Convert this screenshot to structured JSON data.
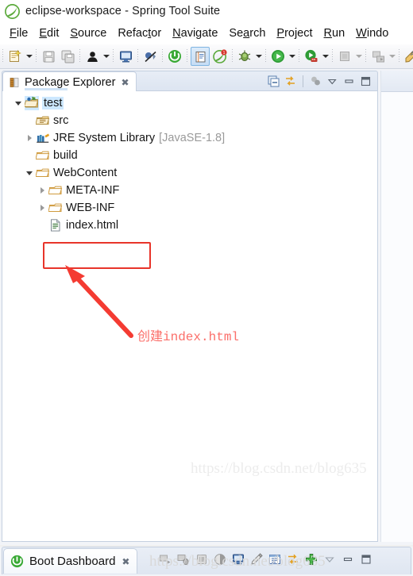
{
  "window": {
    "title": "eclipse-workspace - Spring Tool Suite",
    "logo_icon": "spring-leaf-icon"
  },
  "menubar": {
    "items": [
      {
        "label": "File",
        "mnemonic": "F"
      },
      {
        "label": "Edit",
        "mnemonic": "E"
      },
      {
        "label": "Source",
        "mnemonic": "S"
      },
      {
        "label": "Refactor",
        "mnemonic": "t"
      },
      {
        "label": "Navigate",
        "mnemonic": "N"
      },
      {
        "label": "Search",
        "mnemonic": "a"
      },
      {
        "label": "Project",
        "mnemonic": "P"
      },
      {
        "label": "Run",
        "mnemonic": "R"
      },
      {
        "label": "Windo",
        "mnemonic": "W"
      }
    ]
  },
  "toolbar": {
    "buttons": [
      {
        "name": "new-wizard-icon",
        "label": "New"
      },
      {
        "name": "new-dropdown-arrow",
        "label": "New options"
      },
      {
        "name": "save-icon",
        "label": "Save"
      },
      {
        "name": "save-all-icon",
        "label": "Save All"
      },
      {
        "name": "user-icon",
        "label": "User"
      },
      {
        "name": "user-dropdown-arrow",
        "label": "User options"
      },
      {
        "name": "console-icon",
        "label": "Console"
      },
      {
        "name": "skip-breakpoints-icon",
        "label": "Skip All Breakpoints"
      },
      {
        "name": "boot-start-icon",
        "label": "Boot Start"
      },
      {
        "name": "open-task-icon",
        "label": "Open Task"
      },
      {
        "name": "spring-boot-icon",
        "label": "Spring Boot"
      },
      {
        "name": "debug-icon",
        "label": "Debug"
      },
      {
        "name": "debug-dropdown-arrow",
        "label": "Debug options"
      },
      {
        "name": "run-icon",
        "label": "Run"
      },
      {
        "name": "run-dropdown-arrow",
        "label": "Run options"
      },
      {
        "name": "run-server-icon",
        "label": "Run on Server"
      },
      {
        "name": "run-server-dropdown-arrow",
        "label": "Server options"
      },
      {
        "name": "stop-icon",
        "label": "Stop"
      },
      {
        "name": "stop-dropdown-arrow",
        "label": "Stop options"
      },
      {
        "name": "publish-icon",
        "label": "Publish"
      },
      {
        "name": "publish-dropdown-arrow",
        "label": "Publish options"
      },
      {
        "name": "external-tools-icon",
        "label": "External Tools"
      }
    ]
  },
  "package_explorer": {
    "tab_label": "Package Explorer",
    "tab_icon": "package-explorer-icon",
    "close_icon": "close-icon",
    "tools": [
      {
        "name": "collapse-all-icon",
        "label": "Collapse All"
      },
      {
        "name": "link-with-editor-icon",
        "label": "Link with Editor"
      },
      {
        "name": "focus-on-active-task-icon",
        "label": "Focus on Active Task"
      },
      {
        "name": "view-menu-icon",
        "label": "View Menu"
      },
      {
        "name": "minimize-icon",
        "label": "Minimize"
      },
      {
        "name": "maximize-icon",
        "label": "Maximize"
      }
    ],
    "tree": [
      {
        "label": "test",
        "icon": "java-project-icon",
        "indent": 0,
        "twisty": "open",
        "selected": true,
        "suffix": ""
      },
      {
        "label": "src",
        "icon": "source-folder-icon",
        "indent": 1,
        "twisty": "none",
        "selected": false,
        "suffix": ""
      },
      {
        "label": "JRE System Library",
        "icon": "jre-library-icon",
        "indent": 1,
        "twisty": "closed",
        "selected": false,
        "suffix": "[JavaSE-1.8]"
      },
      {
        "label": "build",
        "icon": "folder-icon",
        "indent": 1,
        "twisty": "none",
        "selected": false,
        "suffix": ""
      },
      {
        "label": "WebContent",
        "icon": "folder-icon",
        "indent": 1,
        "twisty": "open",
        "selected": false,
        "suffix": ""
      },
      {
        "label": "META-INF",
        "icon": "folder-icon",
        "indent": 2,
        "twisty": "closed",
        "selected": false,
        "suffix": ""
      },
      {
        "label": "WEB-INF",
        "icon": "folder-icon",
        "indent": 2,
        "twisty": "closed",
        "selected": false,
        "suffix": ""
      },
      {
        "label": "index.html",
        "icon": "html-file-icon",
        "indent": 2,
        "twisty": "none",
        "selected": false,
        "suffix": ""
      }
    ]
  },
  "annotation": {
    "text": "创建index.html",
    "color": "#fb6f6a",
    "highlight_color": "#e8342a",
    "arrow_name": "red-arrow-annotation",
    "highlight_target": "index.html"
  },
  "boot_dashboard": {
    "tab_label": "Boot Dashboard",
    "tab_icon": "boot-dashboard-icon",
    "close_icon": "close-icon",
    "tools": [
      {
        "name": "start-icon",
        "label": "Start"
      },
      {
        "name": "debug-icon",
        "label": "Debug"
      },
      {
        "name": "stop-icon",
        "label": "Stop"
      },
      {
        "name": "open-browser-icon",
        "label": "Open Web Browser"
      },
      {
        "name": "open-console-icon",
        "label": "Open Console"
      },
      {
        "name": "edit-config-icon",
        "label": "Edit Config"
      },
      {
        "name": "properties-icon",
        "label": "Properties"
      },
      {
        "name": "toggle-request-mappings-icon",
        "label": "Toggle Request Mappings"
      },
      {
        "name": "add-icon",
        "label": "Add"
      },
      {
        "name": "view-menu-icon",
        "label": "View Menu"
      },
      {
        "name": "minimize-icon",
        "label": "Minimize"
      },
      {
        "name": "maximize-icon",
        "label": "Maximize"
      }
    ]
  },
  "watermark": {
    "text": "https://blog.csdn.net/blog635"
  }
}
